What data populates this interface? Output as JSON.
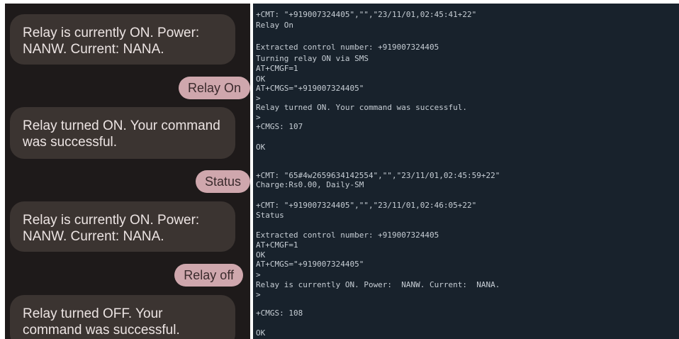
{
  "chat": {
    "messages": [
      {
        "direction": "incoming",
        "text": "Relay is currently ON. Power: NANW. Current:  NANA."
      },
      {
        "direction": "outgoing",
        "text": "Relay On"
      },
      {
        "direction": "incoming",
        "text": "Relay turned ON. Your command was successful."
      },
      {
        "direction": "outgoing",
        "text": "Status"
      },
      {
        "direction": "incoming",
        "text": "Relay is currently ON. Power: NANW. Current:  NANA."
      },
      {
        "direction": "outgoing",
        "text": "Relay off"
      },
      {
        "direction": "incoming",
        "text": "Relay turned OFF. Your command was successful."
      }
    ]
  },
  "terminal": {
    "lines": [
      "+CMT: \"+919007324405\",\"\",\"23/11/01,02:45:41+22\"",
      "Relay On",
      "Extracted control number: +919007324405",
      "Turning relay ON via SMS",
      "AT+CMGF=1",
      "OK",
      "AT+CMGS=\"+919007324405\"",
      ">",
      "Relay turned ON. Your command was successful.",
      ">",
      "+CMGS: 107",
      "OK",
      "+CMT: \"65#4w2659634142554\",\"\",\"23/11/01,02:45:59+22\"",
      "Charge:Rs0.00, Daily-SM",
      "+CMT: \"+919007324405\",\"\",\"23/11/01,02:46:05+22\"",
      "Status",
      "Extracted control number: +919007324405",
      "AT+CMGF=1",
      "OK",
      "AT+CMGS=\"+919007324405\"",
      ">",
      "Relay is currently ON. Power:  NANW. Current:  NANA.",
      ">",
      "+CMGS: 108",
      "OK"
    ]
  }
}
